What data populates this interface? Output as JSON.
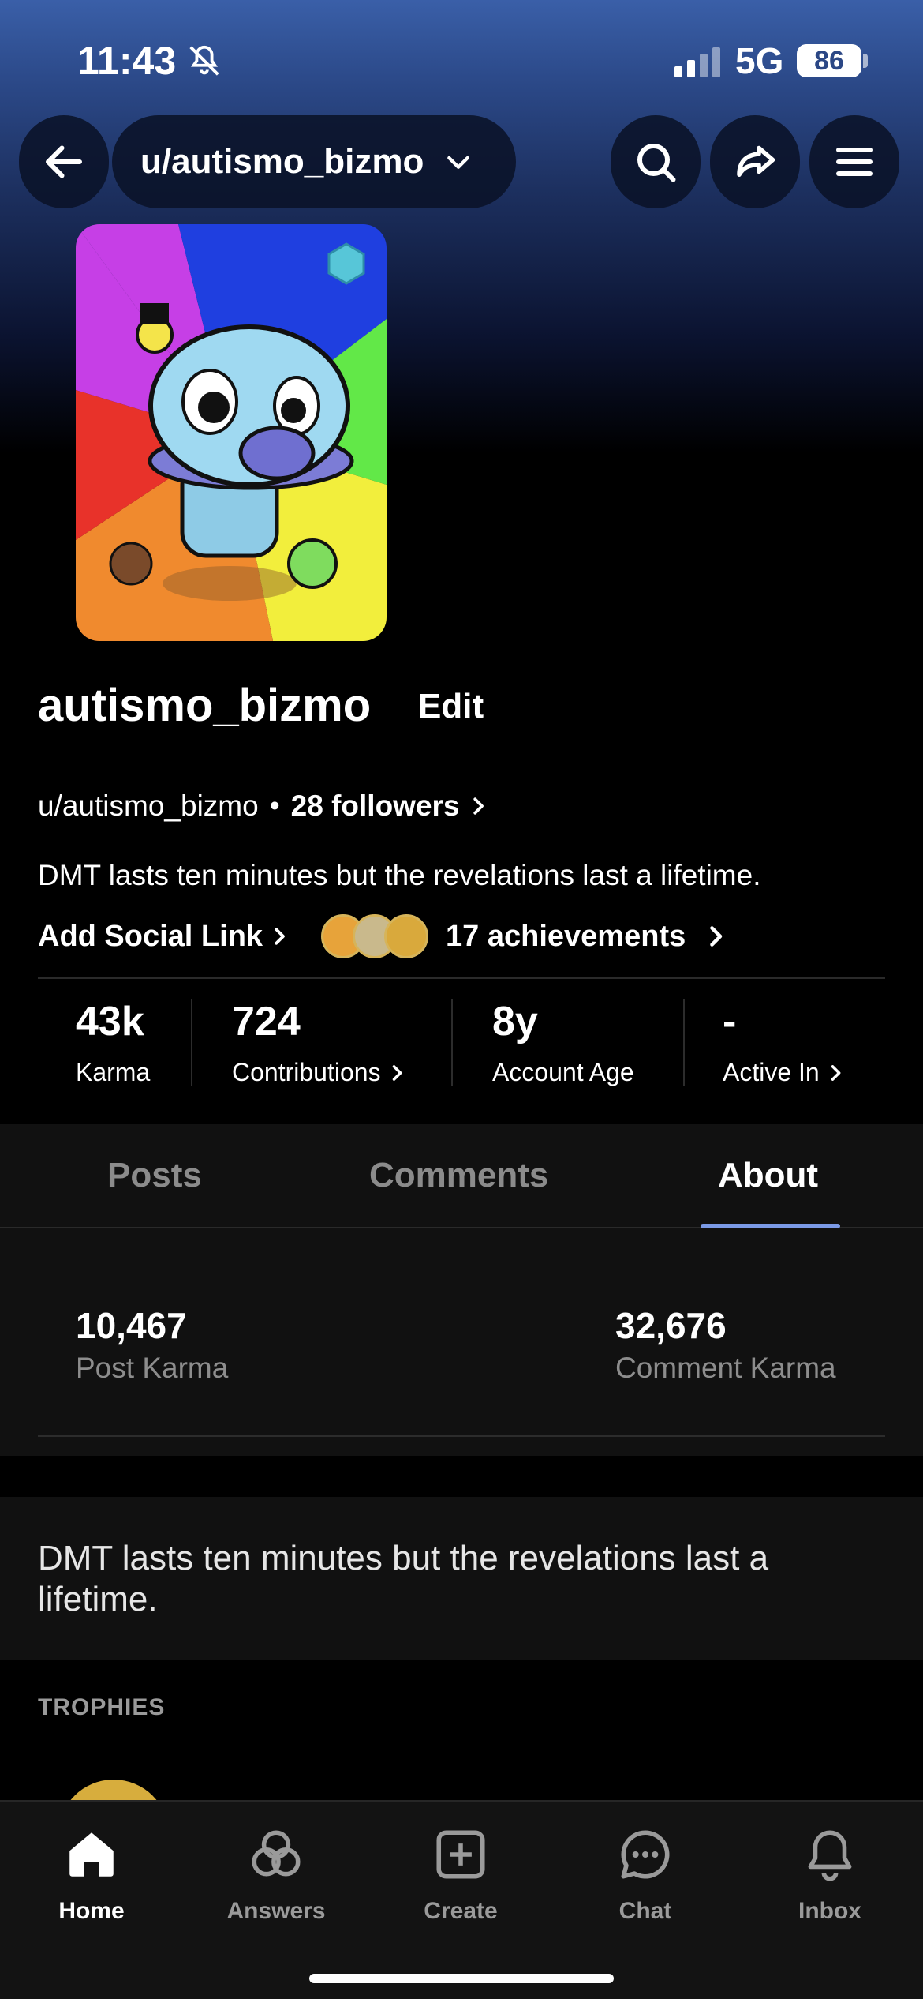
{
  "status_bar": {
    "time": "11:43",
    "network": "5G",
    "battery": "86"
  },
  "header": {
    "username_pill": "u/autismo_bizmo"
  },
  "profile": {
    "display_name": "autismo_bizmo",
    "edit_label": "Edit",
    "handle": "u/autismo_bizmo",
    "separator": "•",
    "followers": "28 followers",
    "bio": "DMT lasts ten minutes but the revelations last a lifetime.",
    "add_social_link": "Add Social Link",
    "achievements": "17 achievements"
  },
  "stats": [
    {
      "value": "43k",
      "label": "Karma"
    },
    {
      "value": "724",
      "label": "Contributions"
    },
    {
      "value": "8y",
      "label": "Account Age"
    },
    {
      "value": "-",
      "label": "Active In"
    }
  ],
  "tabs": [
    {
      "label": "Posts",
      "active": false
    },
    {
      "label": "Comments",
      "active": false
    },
    {
      "label": "About",
      "active": true
    }
  ],
  "about": {
    "post_karma": {
      "value": "10,467",
      "label": "Post Karma"
    },
    "comment_karma": {
      "value": "32,676",
      "label": "Comment Karma"
    },
    "bio": "DMT lasts ten minutes but the revelations last a lifetime.",
    "trophies_heading": "TROPHIES"
  },
  "bottom_nav": [
    {
      "label": "Home",
      "icon": "home-icon",
      "active": true
    },
    {
      "label": "Answers",
      "icon": "answers-icon",
      "active": false
    },
    {
      "label": "Create",
      "icon": "create-icon",
      "active": false
    },
    {
      "label": "Chat",
      "icon": "chat-icon",
      "active": false
    },
    {
      "label": "Inbox",
      "icon": "inbox-icon",
      "active": false
    }
  ],
  "colors": {
    "accent": "#7b9ae6",
    "background": "#000000",
    "panel": "#111111"
  }
}
